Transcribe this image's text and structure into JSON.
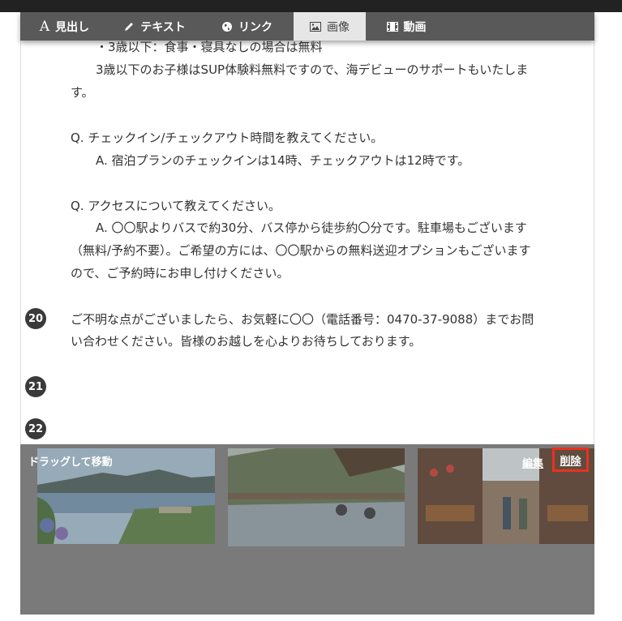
{
  "toolbar": {
    "heading_label": "見出し",
    "text_label": "テキスト",
    "link_label": "リンク",
    "image_label": "画像",
    "video_label": "動画",
    "active_tool": "image"
  },
  "content": {
    "lines": [
      "・3歳以下：食事・寝具なしの場合は無料",
      "3歳以下のお子様はSUP体験料無料ですので、海デビューのサポートもいたしま",
      "す。",
      "Q. チェックイン/チェックアウト時間を教えてください。",
      "A. 宿泊プランのチェックインは14時、チェックアウトは12時です。",
      "Q. アクセスについて教えてください。",
      "A. 〇〇駅よりバスで約30分、バス停から徒歩約〇分です。駐車場もございます",
      "（無料/予約不要）。ご希望の方には、〇〇駅からの無料送迎オプションもございます",
      "ので、ご予約時にお申し付けください。",
      "ご不明な点がございましたら、お気軽に〇〇（電話番号：0470-37-9088）までお問",
      "い合わせください。皆様のお越しを心よりお待ちしております。"
    ]
  },
  "line_numbers": [
    "20",
    "21",
    "22"
  ],
  "image_block": {
    "drag_label": "ドラッグして移動",
    "edit_label": "編集",
    "delete_label": "削除"
  },
  "colors": {
    "toolbar_bg": "#595959",
    "active_tab_bg": "#e6e6e6",
    "overlay_bg": "#7a7a7a",
    "delete_highlight": "#e8321e"
  }
}
